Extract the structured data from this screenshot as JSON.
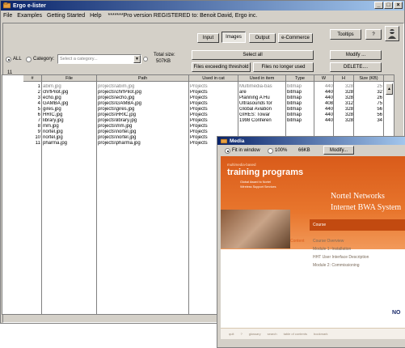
{
  "app": {
    "title": "Ergo e-lister",
    "registration": "*******Pro version REGISTERED to: Benoit David, Ergo inc."
  },
  "menu": [
    "File",
    "Examples",
    "Getting Started",
    "Help"
  ],
  "tabs": [
    "Input",
    "Images",
    "Output",
    "e-Commerce"
  ],
  "active_tab": "Images",
  "toolbar": {
    "tooltips": "Tooltips",
    "help": "?"
  },
  "filter": {
    "all_label": "ALL",
    "category_label": "Category:",
    "category_placeholder": "Select a category...",
    "total_size_label": "Total size:",
    "total_size_value": "507KB",
    "count": "11"
  },
  "actions": {
    "select_all": "Select all",
    "files_exceeding": "Files exceeding threshold",
    "files_unused": "Files no longer used",
    "modify": "Modify ...",
    "delete": "DELETE...."
  },
  "table": {
    "columns": [
      "#",
      "File",
      "Path",
      "Used in cat",
      "Used in item",
      "Type",
      "W",
      "H",
      "Size (KB)"
    ],
    "rows": [
      [
        "1",
        "abim.jpg",
        "projects\\abim.jpg",
        "Projects",
        "Multimedia-bas",
        "bitmap",
        "440",
        "328",
        "25"
      ],
      [
        "2",
        "chrfPilot.jpg",
        "projects\\chrfPilot.jpg",
        "Projects",
        "are",
        "bitmap",
        "440",
        "328",
        "32"
      ],
      [
        "3",
        "echo.jpg",
        "projects\\echo.jpg",
        "Projects",
        "Planning A Hu",
        "bitmap",
        "440",
        "328",
        "26"
      ],
      [
        "4",
        "GAMBA.jpg",
        "projects\\GAMBA.jpg",
        "Projects",
        "Ultrasounds for",
        "bitmap",
        "408",
        "312",
        "75"
      ],
      [
        "5",
        "gires.jpg",
        "projects\\gires.jpg",
        "Projects",
        "Global Aviation",
        "bitmap",
        "440",
        "328",
        "56"
      ],
      [
        "6",
        "HRIC.jpg",
        "projects\\HRIC.jpg",
        "Projects",
        "GIRES: Towar",
        "bitmap",
        "440",
        "328",
        "56"
      ],
      [
        "7",
        "library.jpg",
        "projects\\library.jpg",
        "Projects",
        "1998 Conferen",
        "bitmap",
        "440",
        "328",
        "34"
      ],
      [
        "8",
        "mm.jpg",
        "projects\\mm.jpg",
        "Projects",
        "",
        "",
        "",
        "",
        ""
      ],
      [
        "9",
        "nortel.jpg",
        "projects\\nortel.jpg",
        "Projects",
        "",
        "",
        "",
        "",
        ""
      ],
      [
        "10",
        "nortel.jpg",
        "projects\\nortel.jpg",
        "Projects",
        "",
        "",
        "",
        "",
        ""
      ],
      [
        "11",
        "pharma.jpg",
        "projects\\pharma.jpg",
        "Projects",
        "",
        "",
        "",
        "",
        ""
      ]
    ]
  },
  "media": {
    "title": "Media",
    "fit_label": "Fit in window",
    "zoom_label": "100%",
    "size": "66KB",
    "modify": "Modify...",
    "slide": {
      "brand_small": "multimedia-based",
      "brand": "training programs",
      "sub1": "Global Award to Nortel",
      "sub2": "Wireless Support Services",
      "company1": "Nortel Networks",
      "company2": "Internet BWA System",
      "course_tag": "Course",
      "content_tag": "Content",
      "items": [
        "Course Overview",
        "Module 1: Installation",
        "HHT User Interface Description",
        "Module 2: Commissioning"
      ],
      "logo": "NO",
      "nav": [
        "quit",
        "?",
        "glossary",
        "search",
        "table of contents",
        "bookmark"
      ]
    }
  },
  "colors": {
    "title_bar": "#0a246a",
    "slide_orange": "#e8762d",
    "muted_text": "#808080"
  }
}
